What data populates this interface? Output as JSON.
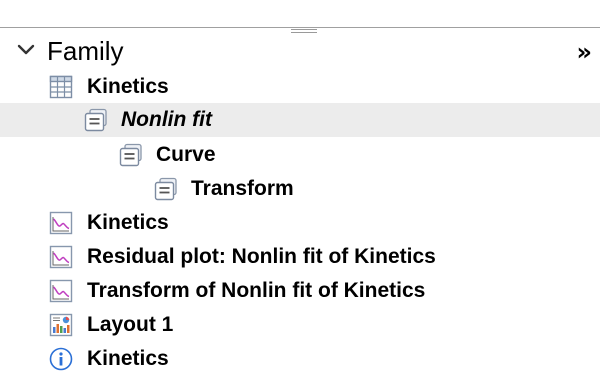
{
  "header": {
    "title": "Family",
    "more_label": "»"
  },
  "items": [
    {
      "label": "Kinetics",
      "icon": "data-table-icon",
      "italic": false,
      "selected": false
    },
    {
      "label": "Nonlin fit",
      "icon": "analysis-icon",
      "italic": true,
      "selected": true
    },
    {
      "label": "Curve",
      "icon": "analysis-icon",
      "italic": false,
      "selected": false
    },
    {
      "label": "Transform",
      "icon": "analysis-icon",
      "italic": false,
      "selected": false
    },
    {
      "label": "Kinetics",
      "icon": "graph-icon",
      "italic": false,
      "selected": false
    },
    {
      "label": "Residual plot: Nonlin fit of Kinetics",
      "icon": "graph-icon",
      "italic": false,
      "selected": false
    },
    {
      "label": "Transform of Nonlin fit of Kinetics",
      "icon": "graph-icon",
      "italic": false,
      "selected": false
    },
    {
      "label": "Layout 1",
      "icon": "layout-icon",
      "italic": false,
      "selected": false
    },
    {
      "label": "Kinetics",
      "icon": "info-icon",
      "italic": false,
      "selected": false
    }
  ],
  "colors": {
    "selected_row": "#ececec",
    "graph_line": "#c040c0",
    "icon_border": "#8a9ab0",
    "info_blue": "#2a6fd6"
  }
}
